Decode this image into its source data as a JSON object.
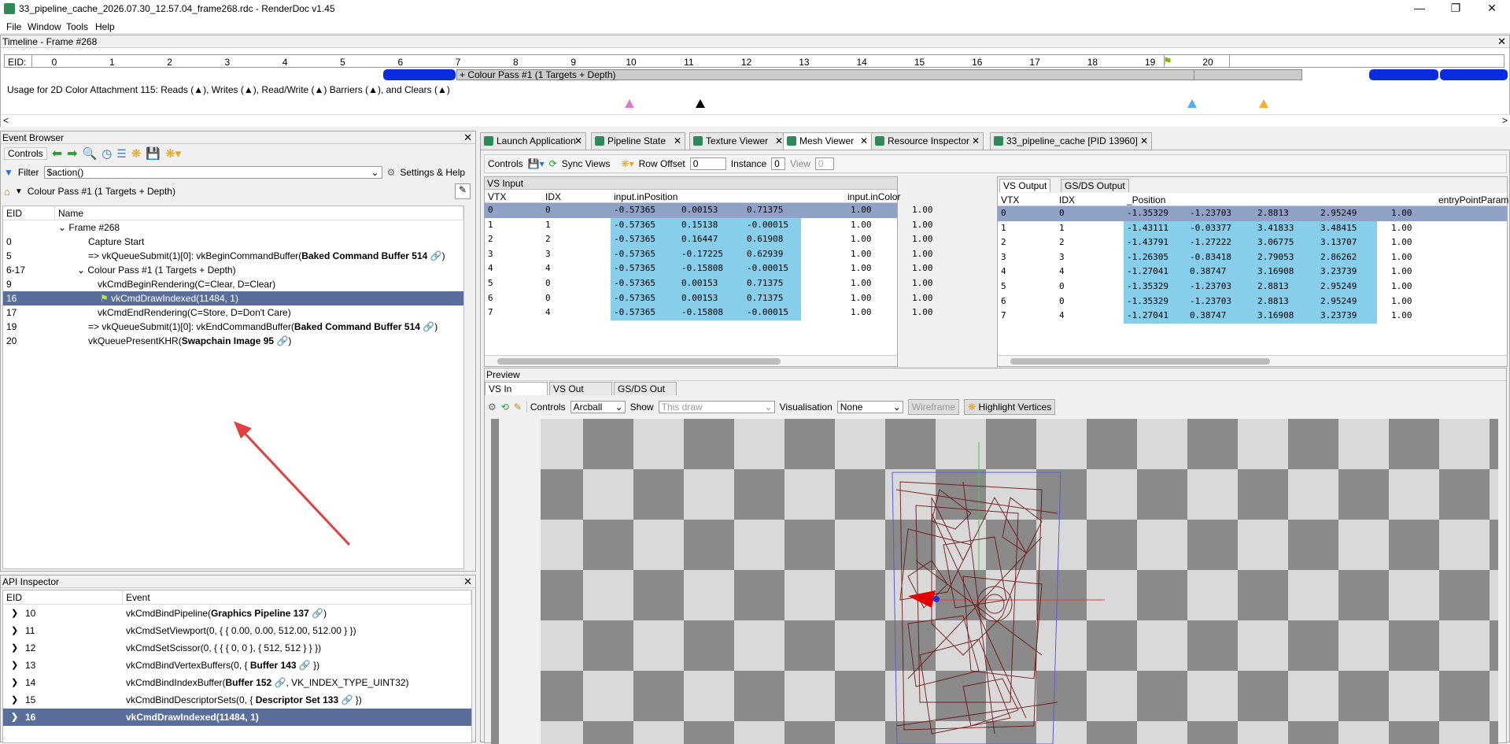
{
  "window": {
    "title": "33_pipeline_cache_2026.07.30_12.57.04_frame268.rdc - RenderDoc v1.45"
  },
  "menu": [
    "File",
    "Window",
    "Tools",
    "Help"
  ],
  "timeline": {
    "header": "Timeline - Frame #268",
    "eid_label": "EID:",
    "ticks": [
      "0",
      "1",
      "2",
      "3",
      "4",
      "5",
      "6",
      "7",
      "8",
      "9",
      "10",
      "11",
      "12",
      "13",
      "14",
      "15",
      "16",
      "17",
      "18",
      "19",
      "20"
    ],
    "pass_label": "+ Colour Pass #1 (1 Targets + Depth)",
    "usage": "Usage for 2D Color Attachment 115: Reads (▲), Writes (▲), Read/Write (▲) Barriers (▲), and Clears (▲)"
  },
  "event_browser": {
    "header": "Event Browser",
    "controls_label": "Controls",
    "filter_label": "Filter",
    "filter_value": "$action()",
    "settings_label": "Settings & Help",
    "breadcrumb": "Colour Pass #1 (1 Targets + Depth)",
    "col_eid": "EID",
    "col_name": "Name",
    "rows": [
      {
        "eid": "",
        "name": "Frame #268"
      },
      {
        "eid": "0",
        "name": "Capture Start"
      },
      {
        "eid": "5",
        "name": "=> vkQueueSubmit(1)[0]: vkBeginCommandBuffer(",
        "bold": "Baked Command Buffer 514",
        "tail": ")"
      },
      {
        "eid": "6-17",
        "name": "Colour Pass #1 (1 Targets + Depth)"
      },
      {
        "eid": "9",
        "name": "vkCmdBeginRendering(C=Clear, D=Clear)"
      },
      {
        "eid": "16",
        "name": "vkCmdDrawIndexed(11484, 1)"
      },
      {
        "eid": "17",
        "name": "vkCmdEndRendering(C=Store, D=Don't Care)"
      },
      {
        "eid": "19",
        "name": "=> vkQueueSubmit(1)[0]: vkEndCommandBuffer(",
        "bold": "Baked Command Buffer 514",
        "tail": ")"
      },
      {
        "eid": "20",
        "name": "vkQueuePresentKHR(",
        "bold": "Swapchain Image 95",
        "tail": ")"
      }
    ]
  },
  "api_inspector": {
    "header": "API Inspector",
    "col_eid": "EID",
    "col_event": "Event",
    "rows": [
      {
        "eid": "10",
        "pre": "vkCmdBindPipeline(",
        "bold": "Graphics Pipeline 137",
        "post": ")"
      },
      {
        "eid": "11",
        "pre": "vkCmdSetViewport(0, { { 0.00, 0.00, 512.00, 512.00 } })",
        "bold": "",
        "post": ""
      },
      {
        "eid": "12",
        "pre": "vkCmdSetScissor(0, { { { 0, 0 }, { 512, 512 } } })",
        "bold": "",
        "post": ""
      },
      {
        "eid": "13",
        "pre": "vkCmdBindVertexBuffers(0, { ",
        "bold": "Buffer 143",
        "post": " })"
      },
      {
        "eid": "14",
        "pre": "vkCmdBindIndexBuffer(",
        "bold": "Buffer 152",
        "post": ", VK_INDEX_TYPE_UINT32)"
      },
      {
        "eid": "15",
        "pre": "vkCmdBindDescriptorSets(0, { ",
        "bold": "Descriptor Set 133",
        "post": " })"
      },
      {
        "eid": "16",
        "pre": "vkCmdDrawIndexed(11484, 1)",
        "bold": "",
        "post": ""
      }
    ]
  },
  "tabs": [
    "Launch Application",
    "Pipeline State",
    "Texture Viewer",
    "Mesh Viewer",
    "Resource Inspector",
    "33_pipeline_cache [PID 13960]"
  ],
  "mesh_viewer": {
    "controls_label": "Controls",
    "sync_views": "Sync Views",
    "row_offset_label": "Row Offset",
    "row_offset": "0",
    "instance_label": "Instance",
    "instance": "0",
    "view_label": "View",
    "view": "0",
    "vs_input": {
      "title": "VS Input",
      "headers": [
        "VTX",
        "IDX",
        "input.inPosition",
        "input.inColor"
      ],
      "rows": [
        [
          "0",
          "0",
          "-0.57365",
          "0.00153",
          "0.71375",
          "1.00",
          "1.00"
        ],
        [
          "1",
          "1",
          "-0.57365",
          "0.15138",
          "-0.00015",
          "1.00",
          "1.00"
        ],
        [
          "2",
          "2",
          "-0.57365",
          "0.16447",
          "0.61908",
          "1.00",
          "1.00"
        ],
        [
          "3",
          "3",
          "-0.57365",
          "-0.17225",
          "0.62939",
          "1.00",
          "1.00"
        ],
        [
          "4",
          "4",
          "-0.57365",
          "-0.15808",
          "-0.00015",
          "1.00",
          "1.00"
        ],
        [
          "5",
          "0",
          "-0.57365",
          "0.00153",
          "0.71375",
          "1.00",
          "1.00"
        ],
        [
          "6",
          "0",
          "-0.57365",
          "0.00153",
          "0.71375",
          "1.00",
          "1.00"
        ],
        [
          "7",
          "4",
          "-0.57365",
          "-0.15808",
          "-0.00015",
          "1.00",
          "1.00"
        ]
      ]
    },
    "vs_output": {
      "tab1": "VS Output",
      "tab2": "GS/DS Output",
      "headers": [
        "VTX",
        "IDX",
        "_Position",
        "entryPointParam"
      ],
      "rows": [
        [
          "0",
          "0",
          "-1.35329",
          "-1.23703",
          "2.8813",
          "2.95249",
          "1.00"
        ],
        [
          "1",
          "1",
          "-1.43111",
          "-0.03377",
          "3.41833",
          "3.48415",
          "1.00"
        ],
        [
          "2",
          "2",
          "-1.43791",
          "-1.27222",
          "3.06775",
          "3.13707",
          "1.00"
        ],
        [
          "3",
          "3",
          "-1.26305",
          "-0.83418",
          "2.79053",
          "2.86262",
          "1.00"
        ],
        [
          "4",
          "4",
          "-1.27041",
          "0.38747",
          "3.16908",
          "3.23739",
          "1.00"
        ],
        [
          "5",
          "0",
          "-1.35329",
          "-1.23703",
          "2.8813",
          "2.95249",
          "1.00"
        ],
        [
          "6",
          "0",
          "-1.35329",
          "-1.23703",
          "2.8813",
          "2.95249",
          "1.00"
        ],
        [
          "7",
          "4",
          "-1.27041",
          "0.38747",
          "3.16908",
          "3.23739",
          "1.00"
        ]
      ]
    },
    "preview": {
      "title": "Preview",
      "tabs": [
        "VS In",
        "VS Out",
        "GS/DS Out"
      ],
      "controls_label": "Controls",
      "controls_value": "Arcball",
      "show_label": "Show",
      "show_value": "This draw",
      "vis_label": "Visualisation",
      "vis_value": "None",
      "wireframe": "Wireframe",
      "highlight": "Highlight Vertices"
    }
  },
  "colors": {
    "accent_selection": "#5a6e9a",
    "timeline_bar": "#0a2be0",
    "cyan_cells": "#87ceeb"
  }
}
